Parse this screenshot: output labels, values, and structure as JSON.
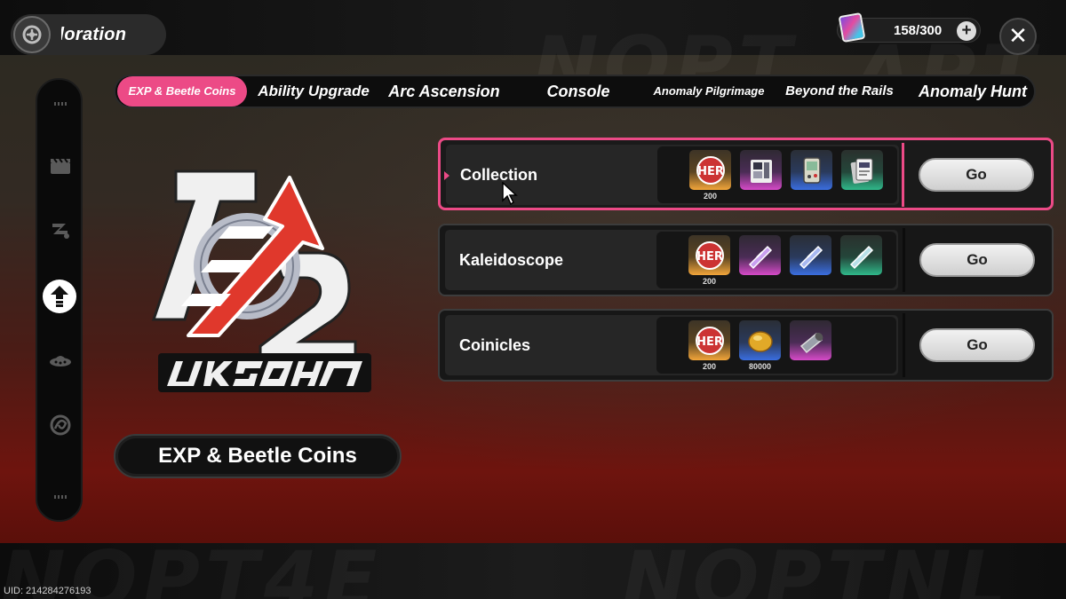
{
  "header": {
    "title": "Exploration",
    "title_visible": "ploration",
    "currency": {
      "value": "158/300",
      "plus_label": "+",
      "icon": "ticket-card-icon"
    },
    "close_label": "✕"
  },
  "sidebar": {
    "items": [
      {
        "icon": "clapperboard-icon",
        "active": false
      },
      {
        "icon": "wing-icon",
        "active": false
      },
      {
        "icon": "upgrade-arrow-icon",
        "active": true
      },
      {
        "icon": "ufo-icon",
        "active": false
      },
      {
        "icon": "spiral-icon",
        "active": false
      }
    ]
  },
  "tabs": [
    {
      "label": "EXP & Beetle Coins",
      "active": true
    },
    {
      "label": "Ability Upgrade",
      "active": false
    },
    {
      "label": "Arc Ascension",
      "active": false
    },
    {
      "label": "Console",
      "active": false
    },
    {
      "label": "Anomaly Pilgrimage",
      "active": false
    },
    {
      "label": "Beyond the Rails",
      "active": false
    },
    {
      "label": "Anomaly Hunt",
      "active": false
    }
  ],
  "category_label": "EXP & Beetle Coins",
  "quests": [
    {
      "name": "Collection",
      "selected": true,
      "go_label": "Go",
      "rewards": [
        {
          "icon": "exp-badge-icon",
          "rarity": "orange",
          "qty": "200"
        },
        {
          "icon": "card-collection-icon",
          "rarity": "purple",
          "qty": ""
        },
        {
          "icon": "gameboy-icon",
          "rarity": "blue",
          "qty": ""
        },
        {
          "icon": "card-stack-icon",
          "rarity": "green",
          "qty": ""
        }
      ]
    },
    {
      "name": "Kaleidoscope",
      "selected": false,
      "go_label": "Go",
      "rewards": [
        {
          "icon": "exp-badge-icon",
          "rarity": "orange",
          "qty": "200"
        },
        {
          "icon": "crystal-tube-icon",
          "rarity": "purple",
          "qty": ""
        },
        {
          "icon": "crystal-tube-icon",
          "rarity": "blue",
          "qty": ""
        },
        {
          "icon": "crystal-tube-icon",
          "rarity": "green",
          "qty": ""
        }
      ]
    },
    {
      "name": "Coinicles",
      "selected": false,
      "go_label": "Go",
      "rewards": [
        {
          "icon": "exp-badge-icon",
          "rarity": "orange",
          "qty": "200"
        },
        {
          "icon": "beetle-coin-icon",
          "rarity": "blue",
          "qty": "80000"
        },
        {
          "icon": "metal-cylinder-icon",
          "rarity": "purple",
          "qty": ""
        }
      ]
    }
  ],
  "footer": {
    "uid": "UID: 214284276193"
  },
  "colors": {
    "accent": "#ec4a86",
    "logo_red": "#e0382c"
  }
}
